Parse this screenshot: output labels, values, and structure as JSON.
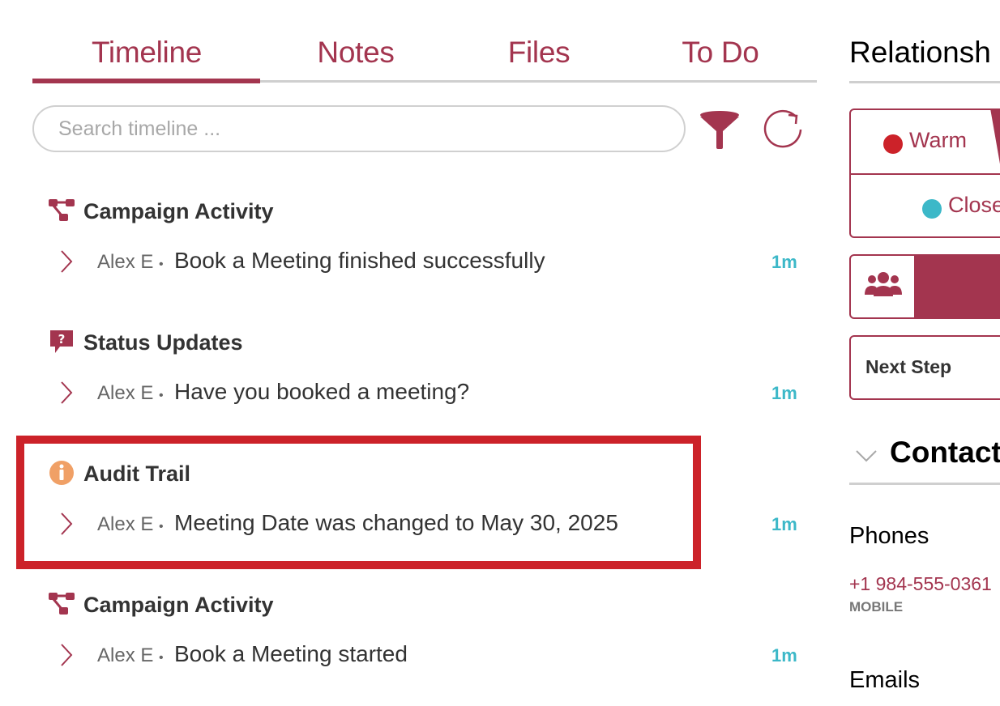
{
  "tabs": {
    "items": [
      {
        "label": "Timeline",
        "active": true
      },
      {
        "label": "Notes",
        "active": false
      },
      {
        "label": "Files",
        "active": false
      },
      {
        "label": "To Do",
        "active": false
      }
    ]
  },
  "search": {
    "placeholder": "Search timeline ...",
    "value": ""
  },
  "toolbar": {
    "filter_icon": "funnel-icon",
    "refresh_icon": "refresh-icon"
  },
  "timeline": {
    "groups": [
      {
        "title": "Campaign Activity",
        "icon": "campaign-flow-icon",
        "entry": {
          "author": "Alex E",
          "separator": "•",
          "text": "Book a Meeting finished successfully",
          "time": "1m"
        }
      },
      {
        "title": "Status Updates",
        "icon": "question-bubble-icon",
        "entry": {
          "author": "Alex E",
          "separator": "•",
          "text": "Have you booked a meeting?",
          "time": "1m"
        }
      },
      {
        "title": "Audit Trail",
        "icon": "info-icon",
        "highlighted": true,
        "entry": {
          "author": "Alex E",
          "separator": "•",
          "text": "Meeting Date was changed to May 30, 2025",
          "time": "1m"
        }
      },
      {
        "title": "Campaign Activity",
        "icon": "campaign-flow-icon",
        "entry": {
          "author": "Alex E",
          "separator": "•",
          "text": "Book a Meeting started",
          "time": "1m"
        }
      }
    ]
  },
  "right_panel": {
    "relationship_title": "Relationsh",
    "relationship": {
      "warm_label": "Warm",
      "close_label": "Close"
    },
    "next_step_label": "Next Step",
    "contact_title": "Contact",
    "phones_title": "Phones",
    "phone": {
      "number": "+1 984-555-0361",
      "type": "MOBILE"
    },
    "emails_title": "Emails"
  },
  "colors": {
    "brand": "#a3354f",
    "time": "#3cb8c8",
    "warm_dot": "#cc2229",
    "close_dot": "#3cb8c8",
    "info_icon": "#f0a066",
    "highlight": "#cc2229"
  }
}
